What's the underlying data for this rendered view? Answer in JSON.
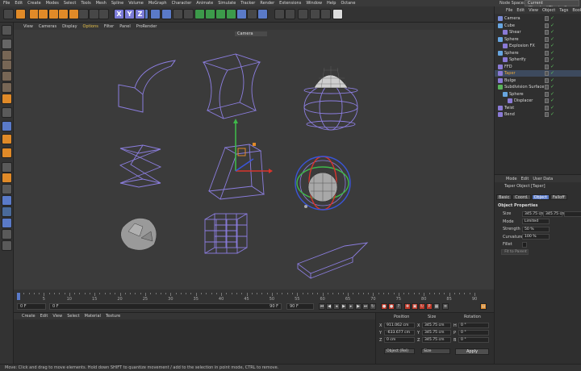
{
  "menubar": {
    "items": [
      "File",
      "Edit",
      "Create",
      "Modes",
      "Select",
      "Tools",
      "Mesh",
      "Spline",
      "Volume",
      "MoGraph",
      "Character",
      "Animate",
      "Simulate",
      "Tracker",
      "Render",
      "Extensions",
      "Window",
      "Help",
      "Octane"
    ],
    "node_space_label": "Node Space:",
    "node_space_value": "Current (Standard/Physical)"
  },
  "toolbar": {
    "axis_labels": [
      "X",
      "Y",
      "Z"
    ],
    "icons": [
      "undo-icon",
      "select-live-icon",
      "move-icon",
      "scale-icon",
      "rotate-icon",
      "recent-icon",
      "move-icon",
      "axis-x-icon",
      "axis-y-icon",
      "axis-z-icon",
      "coord-system-icon",
      "render-view-icon",
      "render-settings-icon",
      "render-region-icon",
      "cube-icon",
      "pen-icon",
      "subdivide-icon",
      "cloner-icon",
      "instance-icon",
      "deformer-icon",
      "floor-icon",
      "camera-icon",
      "light-icon"
    ]
  },
  "viewport_menu": {
    "items": [
      "View",
      "Cameras",
      "Display",
      "Options",
      "Filter",
      "Panel",
      "ProRender"
    ],
    "active": "Options",
    "camera_label": "Camera"
  },
  "timeline": {
    "ticks": [
      "0",
      "5",
      "10",
      "15",
      "20",
      "25",
      "30",
      "35",
      "40",
      "45",
      "50",
      "55",
      "60",
      "65",
      "70",
      "75",
      "80",
      "85",
      "90"
    ],
    "current_frame": "0 F",
    "start_frame": "0 F",
    "end_frame": "90 F",
    "end_frame2": "90 F"
  },
  "materials": {
    "menu": [
      "Create",
      "Edit",
      "View",
      "Select",
      "Material",
      "Texture"
    ]
  },
  "coordinates": {
    "headers": [
      "Position",
      "Size",
      "Rotation"
    ],
    "rows": [
      {
        "axis": "X",
        "pos": "911.062 cm",
        "size_axis": "X",
        "size": "345.75 cm",
        "rot_axis": "H",
        "rot": "0 °"
      },
      {
        "axis": "Y",
        "pos": "-633.677 cm",
        "size_axis": "Y",
        "size": "345.75 cm",
        "rot_axis": "P",
        "rot": "0 °"
      },
      {
        "axis": "Z",
        "pos": "0 cm",
        "size_axis": "Z",
        "size": "345.75 cm",
        "rot_axis": "B",
        "rot": "0 °"
      }
    ],
    "mode_select": "Object (Rel)",
    "size_select": "Size",
    "apply_label": "Apply"
  },
  "status": "Move: Click and drag to move elements. Hold down SHIFT to quantize movement / add to the selection in point mode, CTRL to remove.",
  "objects": {
    "menu": [
      "File",
      "Edit",
      "View",
      "Object",
      "Tags",
      "Bookm"
    ],
    "items": [
      {
        "name": "Camera",
        "indent": 0,
        "icon": "#7a8bd6",
        "selected": false
      },
      {
        "name": "Cube",
        "indent": 0,
        "icon": "#67a5e0",
        "selected": false
      },
      {
        "name": "Shear",
        "indent": 1,
        "icon": "#8a7ad6",
        "selected": false
      },
      {
        "name": "Sphere",
        "indent": 0,
        "icon": "#67a5e0",
        "selected": false
      },
      {
        "name": "Explosion FX",
        "indent": 1,
        "icon": "#8a7ad6",
        "selected": false
      },
      {
        "name": "Sphere",
        "indent": 0,
        "icon": "#67a5e0",
        "selected": false
      },
      {
        "name": "Spherify",
        "indent": 1,
        "icon": "#8a7ad6",
        "selected": false
      },
      {
        "name": "FFD",
        "indent": 0,
        "icon": "#8a7ad6",
        "selected": false
      },
      {
        "name": "Taper",
        "indent": 0,
        "icon": "#8a7ad6",
        "selected": true
      },
      {
        "name": "Bulge",
        "indent": 0,
        "icon": "#8a7ad6",
        "selected": false
      },
      {
        "name": "Subdivision Surface",
        "indent": 0,
        "icon": "#5ab45a",
        "selected": false
      },
      {
        "name": "Sphere",
        "indent": 1,
        "icon": "#67a5e0",
        "selected": false
      },
      {
        "name": "Displacer",
        "indent": 2,
        "icon": "#8a7ad6",
        "selected": false
      },
      {
        "name": "Twist",
        "indent": 0,
        "icon": "#8a7ad6",
        "selected": false
      },
      {
        "name": "Bend",
        "indent": 0,
        "icon": "#8a7ad6",
        "selected": false
      }
    ]
  },
  "attributes": {
    "menu": [
      "Mode",
      "Edit",
      "User Data"
    ],
    "title": "Taper Object [Taper]",
    "tabs": [
      "Basic",
      "Coord.",
      "Object",
      "Falloff"
    ],
    "active_tab": "Object",
    "section": "Object Properties",
    "props": [
      {
        "label": "Size",
        "values": [
          "345.75 cm",
          "345.75 cm",
          ""
        ]
      },
      {
        "label": "Mode",
        "values": [
          "Limited"
        ]
      },
      {
        "label": "Strength",
        "values": [
          "50 %"
        ]
      },
      {
        "label": "Curvature",
        "values": [
          "100 %"
        ]
      },
      {
        "label": "Fillet",
        "values": [
          ""
        ]
      }
    ],
    "fit_button": "Fit to Parent"
  },
  "colors": {
    "accent": "#5a7ac8",
    "orange": "#e08a28",
    "wire": "#8c7ee0",
    "bg_viewport": "#3b3b3b"
  }
}
